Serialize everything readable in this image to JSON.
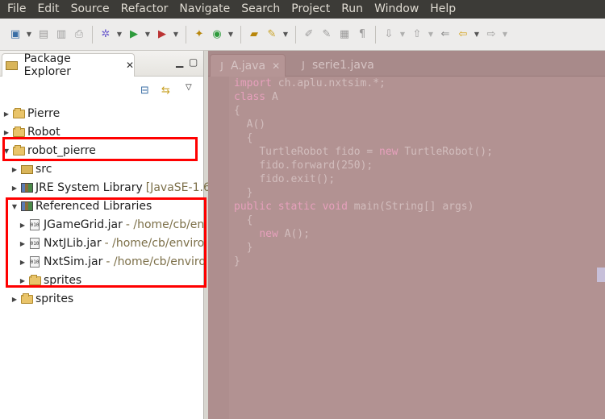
{
  "menubar": {
    "items": [
      "File",
      "Edit",
      "Source",
      "Refactor",
      "Navigate",
      "Search",
      "Project",
      "Run",
      "Window",
      "Help"
    ]
  },
  "panel": {
    "title": "Package Explorer",
    "tree": [
      {
        "label": "Pierre",
        "suffix": "",
        "icon": "project-folder-icon",
        "expanded": false
      },
      {
        "label": "Robot",
        "suffix": "",
        "icon": "project-folder-icon",
        "expanded": false
      },
      {
        "label": "robot_pierre",
        "suffix": "",
        "icon": "project-folder-icon",
        "expanded": true
      },
      {
        "label": "src",
        "suffix": "",
        "icon": "source-folder-icon",
        "expanded": false
      },
      {
        "label": "JRE System Library",
        "suffix": "[JavaSE-1.6",
        "icon": "library-icon",
        "expanded": false
      },
      {
        "label": "Referenced Libraries",
        "suffix": "",
        "icon": "library-icon",
        "expanded": true
      },
      {
        "label": "JGameGrid.jar",
        "suffix": "- /home/cb/en",
        "icon": "jar-icon",
        "expanded": false
      },
      {
        "label": "NxtJLib.jar",
        "suffix": "- /home/cb/enviro",
        "icon": "jar-icon",
        "expanded": false
      },
      {
        "label": "NxtSim.jar",
        "suffix": "- /home/cb/enviro",
        "icon": "jar-icon",
        "expanded": false
      },
      {
        "label": "sprites",
        "suffix": "",
        "icon": "class-folder-icon",
        "expanded": false
      },
      {
        "label": "sprites",
        "suffix": "",
        "icon": "folder-icon",
        "expanded": false
      }
    ]
  },
  "editor": {
    "tabs": [
      {
        "label": "A.java",
        "active": true
      },
      {
        "label": "serie1.java",
        "active": false
      }
    ],
    "code": [
      "import ch.aplu.nxtsim.*;",
      "class A",
      "{",
      "  A()",
      "  {",
      "    TurtleRobot fido = new TurtleRobot();",
      "    fido.forward(250);",
      "    fido.exit();",
      "  }",
      "public static void main(String[] args)",
      "  {",
      "    new A();",
      "  }",
      "}"
    ]
  },
  "colors": {
    "highlight_box": "#ff0000",
    "editor_overlay": "#b29292",
    "menubar_bg": "#3c3b37"
  }
}
